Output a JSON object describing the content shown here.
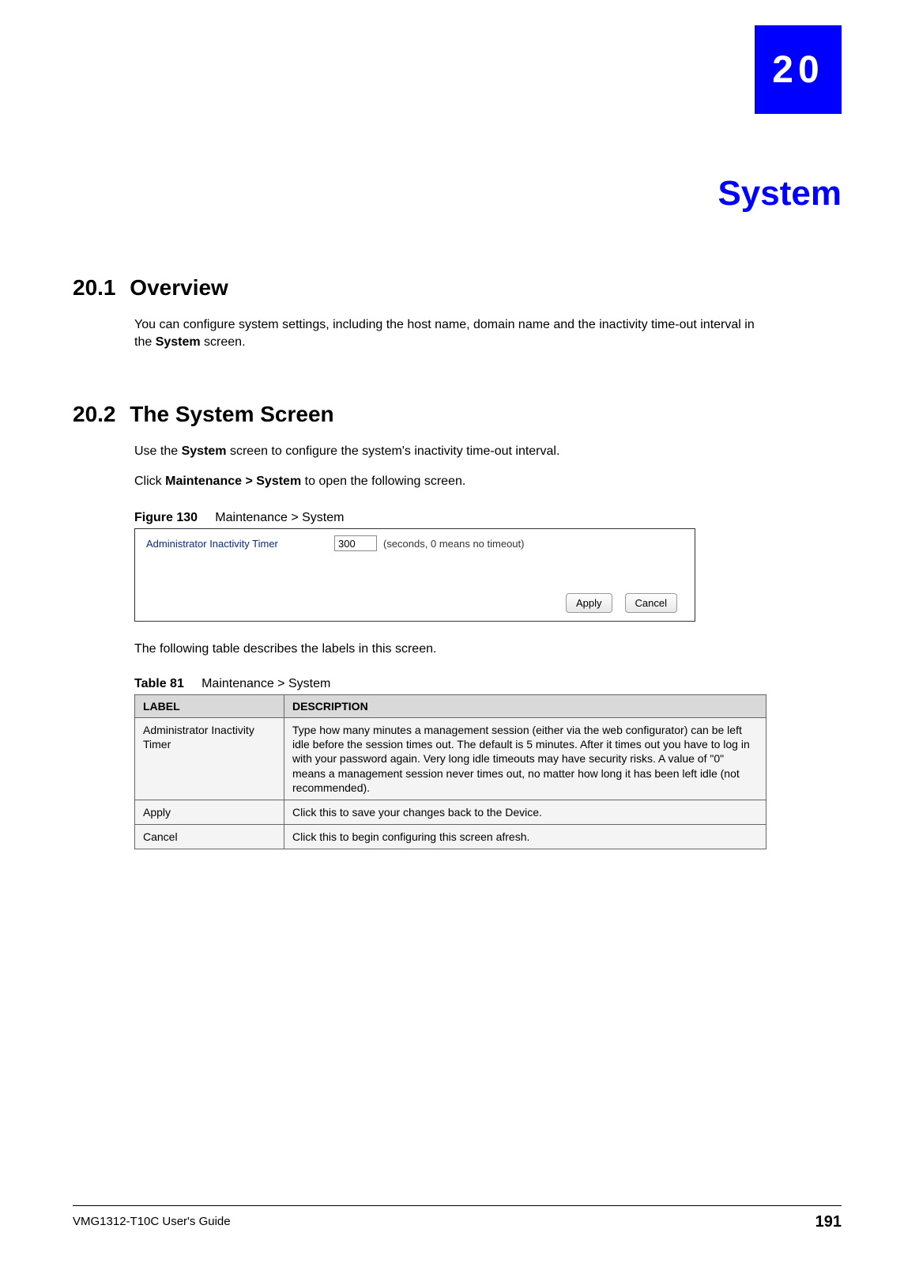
{
  "chapter": {
    "number": "20",
    "title": "System"
  },
  "sections": {
    "overview": {
      "heading_num": "20.1",
      "heading_title": "Overview",
      "body_pre": "You can configure system settings, including the host name, domain name and the inactivity time-out interval in the ",
      "body_bold": "System",
      "body_post": " screen."
    },
    "system_screen": {
      "heading_num": "20.2",
      "heading_title": "The System Screen",
      "para1_pre": "Use the ",
      "para1_bold": "System",
      "para1_post": " screen to configure the system's inactivity time-out interval.",
      "para2_pre": "Click ",
      "para2_bold": "Maintenance > System",
      "para2_post": " to open the following screen."
    }
  },
  "figure": {
    "caption_label": "Figure 130",
    "caption_text": "Maintenance > System",
    "field_label": "Administrator Inactivity Timer",
    "field_value": "300",
    "field_hint": "(seconds, 0 means no timeout)",
    "apply_label": "Apply",
    "cancel_label": "Cancel"
  },
  "after_table_text": "The following table describes the labels in this screen.",
  "table": {
    "caption_label": "Table 81",
    "caption_text": "Maintenance > System",
    "headers": {
      "label": "LABEL",
      "description": "DESCRIPTION"
    },
    "rows": [
      {
        "label": "Administrator Inactivity Timer",
        "description": "Type how many minutes a management session (either via the web configurator) can be left idle before the session times out. The default is 5 minutes. After it times out you have to log in with your password again. Very long idle timeouts may have security risks. A value of \"0\" means a management session never times out, no matter how long it has been left idle (not recommended)."
      },
      {
        "label": "Apply",
        "description": "Click this to save your changes back to the Device."
      },
      {
        "label": "Cancel",
        "description": "Click this to begin configuring this screen afresh."
      }
    ]
  },
  "footer": {
    "guide": "VMG1312-T10C User's Guide",
    "page": "191"
  }
}
